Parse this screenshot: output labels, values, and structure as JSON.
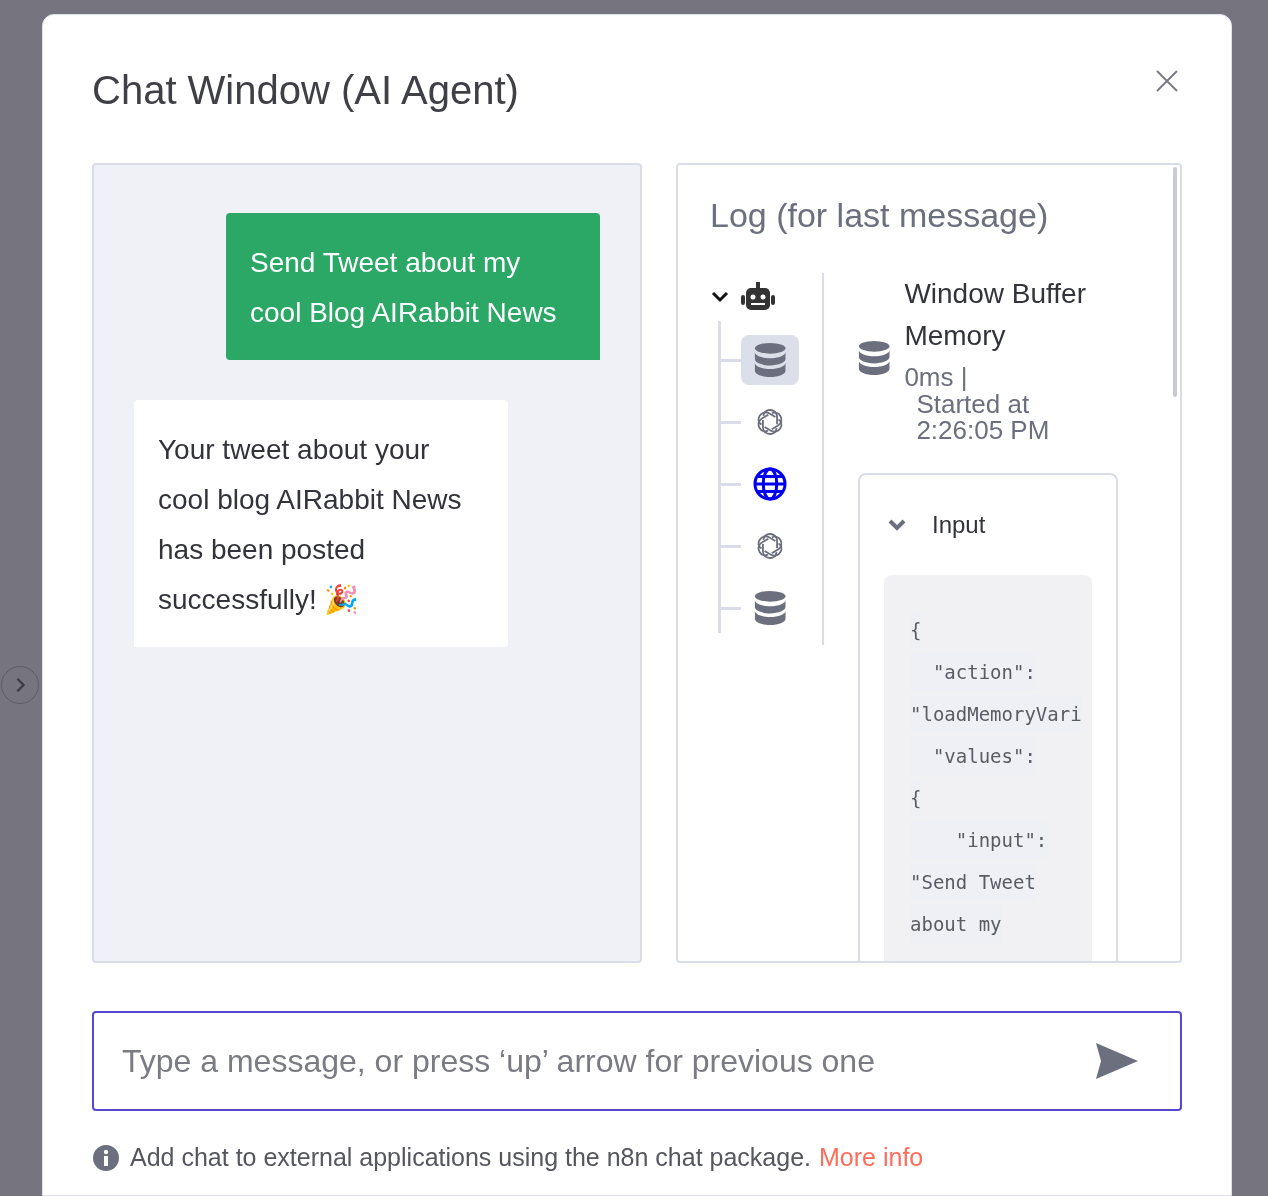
{
  "dialog": {
    "title": "Chat Window (AI Agent)"
  },
  "chat": {
    "messages": [
      {
        "kind": "user",
        "text": "Send Tweet about my cool Blog AIRabbit News"
      },
      {
        "kind": "bot",
        "text": "Your tweet about your cool blog AIRabbit News has been posted successfully! 🎉"
      }
    ]
  },
  "log": {
    "title": "Log (for last message)",
    "tree": {
      "kind": "robot",
      "expanded": true,
      "children": [
        {
          "kind": "database",
          "selected": true
        },
        {
          "kind": "openai",
          "selected": false
        },
        {
          "kind": "globe",
          "selected": false
        },
        {
          "kind": "openai",
          "selected": false
        },
        {
          "kind": "database",
          "selected": false
        }
      ]
    },
    "detail": {
      "kind": "database",
      "title": "Window Buffer Memory",
      "duration": "0ms |",
      "started": "Started at 2:26:05 PM",
      "input": {
        "label": "Input",
        "expanded": true,
        "lines": [
          "{",
          "  \"action\":",
          "\"loadMemoryVari",
          "  \"values\":",
          "{",
          "    \"input\":",
          "\"Send Tweet",
          "about my"
        ]
      }
    }
  },
  "composer": {
    "placeholder": "Type a message, or press ‘up’ arrow for previous one"
  },
  "footer": {
    "text": "Add chat to external applications using the n8n chat package.",
    "link": "More info"
  }
}
